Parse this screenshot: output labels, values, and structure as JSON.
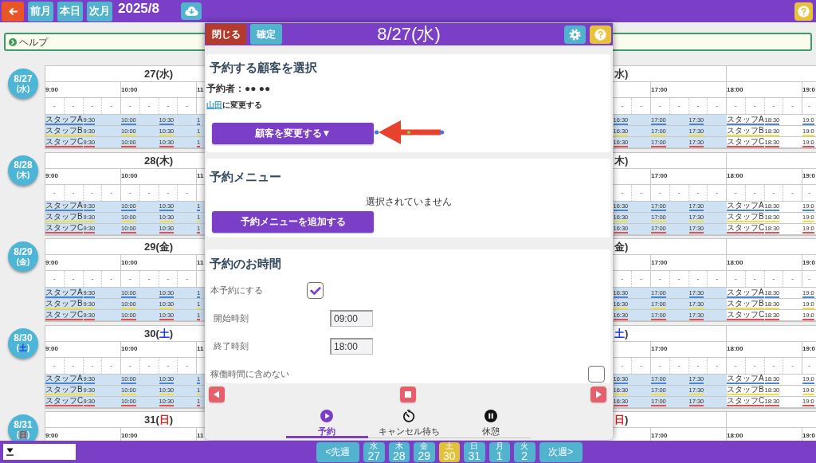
{
  "top_bar": {
    "buttons": [
      "前月",
      "本日",
      "次月"
    ],
    "title": "2025/8"
  },
  "help_bar": {
    "label": "ヘルプ"
  },
  "days": [
    {
      "kind": "weekday",
      "badge": {
        "date": "8/27",
        "before": "(",
        "weekday": "水",
        "after": ")"
      },
      "header_left": {
        "before": "27(",
        "weekday": "水",
        "after": ")"
      },
      "header_right": {
        "weekday": "水",
        "after": ")"
      },
      "hours_left": [
        "9:00",
        "10:00",
        "11"
      ],
      "hours_right": [
        "17:00",
        "18:00",
        "19:0"
      ],
      "slots_left": [
        "-",
        "-",
        "-",
        "-",
        "-",
        "-",
        "-",
        "-"
      ],
      "slots_right": [
        "-",
        "-",
        "-",
        "-",
        "-",
        "-",
        "-",
        "-",
        "-",
        "-",
        "-"
      ],
      "staff": [
        {
          "color": "#4a86d8",
          "left_on_shift": [
            "スタッフA",
            "9:30",
            "10:00",
            "10:30",
            "1"
          ],
          "right_on_shift": [
            "16:30",
            "17:00",
            "17:30"
          ],
          "right_off_shift": [
            "スタッフA",
            "18:30",
            "19:0"
          ]
        },
        {
          "color": "#efe04a",
          "left_on_shift": [
            "スタッフB",
            "9:30",
            "10:00",
            "10:30",
            "1"
          ],
          "right_on_shift": [
            "16:30",
            "17:00",
            "17:30"
          ],
          "right_off_shift": [
            "スタッフB",
            "18:30",
            "19:0"
          ]
        },
        {
          "color": "#e05252",
          "left_on_shift": [
            "スタッフC",
            "9:30",
            "10:00",
            "10:30",
            "1"
          ],
          "right_on_shift": [
            "16:30",
            "17:00",
            "17:30"
          ],
          "right_off_shift": [
            "スタッフC",
            "18:30",
            "19:0"
          ]
        }
      ]
    },
    {
      "kind": "weekday",
      "badge": {
        "date": "8/28",
        "before": "(",
        "weekday": "木",
        "after": ")"
      },
      "header_left": {
        "before": "28(",
        "weekday": "木",
        "after": ")"
      },
      "header_right": {
        "weekday": "木",
        "after": ")"
      },
      "hours_left": [
        "9:00",
        "10:00",
        "11"
      ],
      "hours_right": [
        "17:00",
        "18:00",
        "19:0"
      ],
      "slots_left": [
        "-",
        "-",
        "-",
        "-",
        "-",
        "-",
        "-",
        "-"
      ],
      "slots_right": [
        "-",
        "-",
        "-",
        "-",
        "-",
        "-",
        "-",
        "-",
        "-",
        "-",
        "-"
      ],
      "staff": [
        {
          "color": "#4a86d8",
          "left_on_shift": [
            "スタッフA",
            "9:30",
            "10:00",
            "10:30",
            "1"
          ],
          "right_on_shift": [
            "16:30",
            "17:00",
            "17:30"
          ],
          "right_off_shift": [
            "スタッフA",
            "18:30",
            "19:0"
          ]
        },
        {
          "color": "#efe04a",
          "left_on_shift": [
            "スタッフB",
            "9:30",
            "10:00",
            "10:30",
            "1"
          ],
          "right_on_shift": [
            "16:30",
            "17:00",
            "17:30"
          ],
          "right_off_shift": [
            "スタッフB",
            "18:30",
            "19:0"
          ]
        },
        {
          "color": "#e05252",
          "left_on_shift": [
            "スタッフC",
            "9:30",
            "10:00",
            "10:30",
            "1"
          ],
          "right_on_shift": [
            "16:30",
            "17:00",
            "17:30"
          ],
          "right_off_shift": [
            "スタッフC",
            "18:30",
            "19:0"
          ]
        }
      ]
    },
    {
      "kind": "weekday",
      "badge": {
        "date": "8/29",
        "before": "(",
        "weekday": "金",
        "after": ")"
      },
      "header_left": {
        "before": "29(",
        "weekday": "金",
        "after": ")"
      },
      "header_right": {
        "weekday": "金",
        "after": ")"
      },
      "hours_left": [
        "9:00",
        "10:00",
        "11"
      ],
      "hours_right": [
        "17:00",
        "18:00",
        "19:0"
      ],
      "slots_left": [
        "-",
        "-",
        "-",
        "-",
        "-",
        "-",
        "-",
        "-"
      ],
      "slots_right": [
        "-",
        "-",
        "-",
        "-",
        "-",
        "-",
        "-",
        "-",
        "-",
        "-",
        "-"
      ],
      "staff": [
        {
          "color": "#4a86d8",
          "left_on_shift": [
            "スタッフA",
            "9:30",
            "10:00",
            "10:30",
            "1"
          ],
          "right_on_shift": [
            "16:30",
            "17:00",
            "17:30"
          ],
          "right_off_shift": [
            "スタッフA",
            "18:30",
            "19:0"
          ]
        },
        {
          "color": "#efe04a",
          "left_on_shift": [
            "スタッフB",
            "9:30",
            "10:00",
            "10:30",
            "1"
          ],
          "right_on_shift": [
            "16:30",
            "17:00",
            "17:30"
          ],
          "right_off_shift": [
            "スタッフB",
            "18:30",
            "19:0"
          ]
        },
        {
          "color": "#e05252",
          "left_on_shift": [
            "スタッフC",
            "9:30",
            "10:00",
            "10:30",
            "1"
          ],
          "right_on_shift": [
            "16:30",
            "17:00",
            "17:30"
          ],
          "right_off_shift": [
            "スタッフC",
            "18:30",
            "19:0"
          ]
        }
      ]
    },
    {
      "kind": "saturday",
      "badge": {
        "date": "8/30",
        "before": "(",
        "weekday": "土",
        "after": ")"
      },
      "header_left": {
        "before": "30(",
        "weekday": "土",
        "after": ")"
      },
      "header_right": {
        "weekday": "土",
        "after": ")"
      },
      "hours_left": [
        "9:00",
        "10:00",
        "11"
      ],
      "hours_right": [
        "17:00",
        "18:00",
        "19:0"
      ],
      "slots_left": [
        "-",
        "-",
        "-",
        "-",
        "-",
        "-",
        "-",
        "-"
      ],
      "slots_right": [
        "-",
        "-",
        "-",
        "-",
        "-",
        "-",
        "-",
        "-",
        "-",
        "-",
        "-"
      ],
      "staff": [
        {
          "color": "#4a86d8",
          "left_on_shift": [
            "スタッフA",
            "9:30",
            "10:00",
            "10:30",
            "1"
          ],
          "right_on_shift": [
            "16:30",
            "17:00",
            "17:30"
          ],
          "right_off_shift": [
            "スタッフA",
            "18:30",
            "19:0"
          ]
        },
        {
          "color": "#efe04a",
          "left_on_shift": [
            "スタッフB",
            "9:30",
            "10:00",
            "10:30",
            "1"
          ],
          "right_on_shift": [
            "16:30",
            "17:00",
            "17:30"
          ],
          "right_off_shift": [
            "スタッフB",
            "18:30",
            "19:0"
          ]
        },
        {
          "color": "#e05252",
          "left_on_shift": [
            "スタッフC",
            "9:30",
            "10:00",
            "10:30",
            "1"
          ],
          "right_on_shift": [
            "16:30",
            "17:00",
            "17:30"
          ],
          "right_off_shift": [
            "スタッフC",
            "18:30",
            "19:0"
          ]
        }
      ]
    },
    {
      "kind": "sunday",
      "badge": {
        "date": "8/31",
        "before": "(",
        "weekday": "日",
        "after": ")"
      },
      "header_left": {
        "before": "31(",
        "weekday": "日",
        "after": ")"
      },
      "header_right": {
        "weekday": "日",
        "after": ")"
      },
      "hours_left": [
        "9:00",
        "10:00",
        "11"
      ],
      "hours_right": [
        "17:00",
        "18:00",
        "19:0"
      ]
    }
  ],
  "modal": {
    "close": "閉じる",
    "confirm": "確定",
    "title": "8/27(水)",
    "customer": {
      "title": "予約する顧客を選択",
      "booker": "予約者：●● ●●",
      "link": "山田",
      "link_suffix": "に変更する",
      "button": "顧客を変更する▼"
    },
    "menu": {
      "title": "予約メニュー",
      "empty": "選択されていません",
      "button": "予約メニューを追加する"
    },
    "time": {
      "title": "予約のお時間",
      "rows": [
        {
          "kind": "check",
          "label": "本予約にする",
          "checked": true
        },
        {
          "kind": "time",
          "label": "開始時刻",
          "value": "09:00"
        },
        {
          "kind": "time",
          "label": "終了時刻",
          "value": "18:00"
        },
        {
          "kind": "option",
          "label": "稼働時間に含めない",
          "checked": false
        }
      ]
    },
    "tabs": [
      {
        "kind": "play",
        "label": "予約",
        "selected": true
      },
      {
        "kind": "timer",
        "label": "キャンセル待ち",
        "selected": false
      },
      {
        "kind": "pause",
        "label": "休憩",
        "selected": false
      }
    ]
  },
  "bottom_bar": {
    "prev": "<先週",
    "next": "次週>",
    "days": [
      {
        "weekday": "水",
        "date": "27",
        "today": false
      },
      {
        "weekday": "木",
        "date": "28",
        "today": false
      },
      {
        "weekday": "金",
        "date": "29",
        "today": false
      },
      {
        "weekday": "土",
        "date": "30",
        "today": true
      },
      {
        "weekday": "日",
        "date": "31",
        "today": false
      },
      {
        "weekday": "月",
        "date": "1",
        "today": false
      },
      {
        "weekday": "火",
        "date": "2",
        "today": false
      }
    ]
  }
}
